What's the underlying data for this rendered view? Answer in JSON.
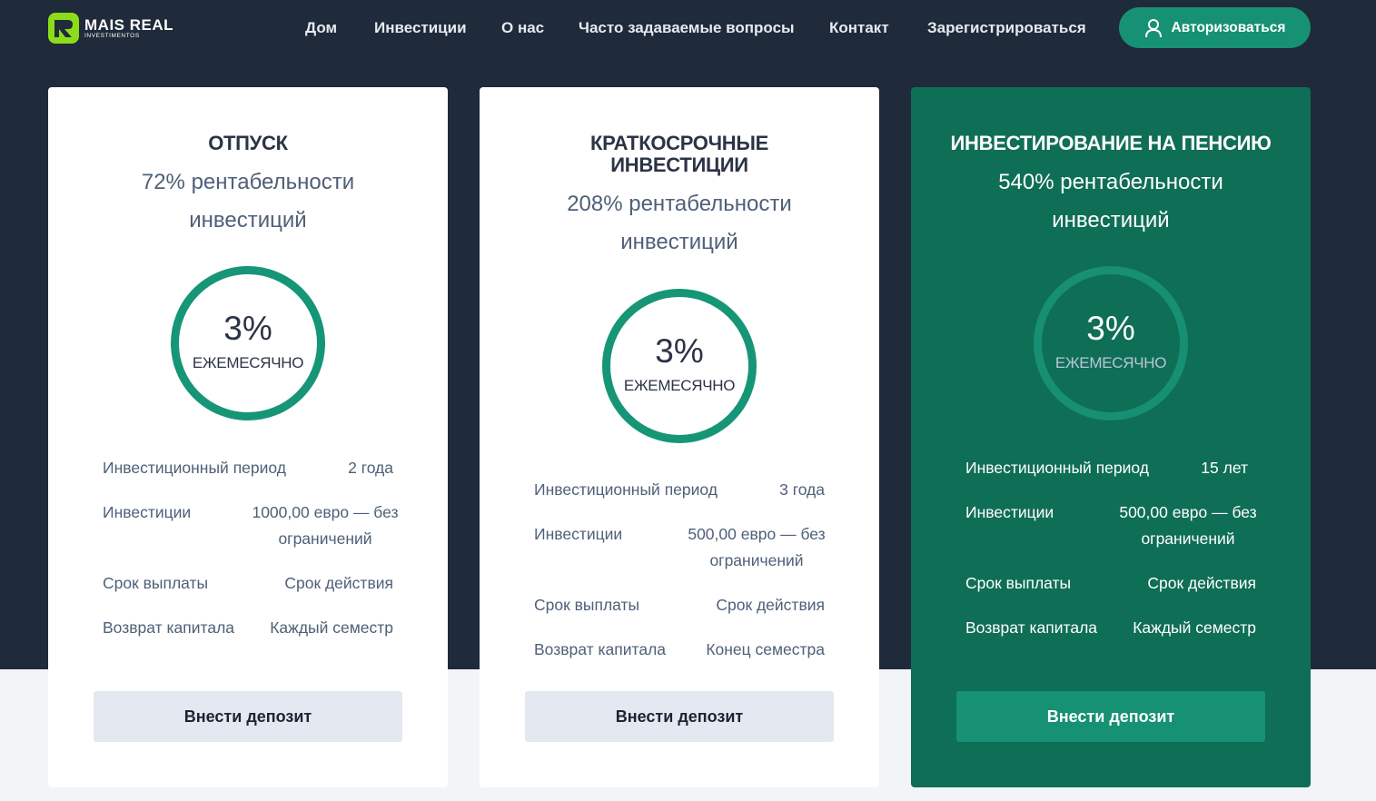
{
  "brand": {
    "name": "MAIS REAL",
    "sub": "INVESTIMENTOS",
    "accent": "#8bdc19"
  },
  "nav": {
    "items": [
      "Дом",
      "Инвестиции",
      "О нас",
      "Часто задаваемые вопросы",
      "Контакт",
      "Зарегистрироваться"
    ],
    "login_label": "Авторизоваться",
    "login_icon": "user-icon"
  },
  "colors": {
    "header_bg": "#1f2a3a",
    "accent_green": "#179173",
    "featured_bg": "#0f6e56"
  },
  "plans": [
    {
      "title": "ОТПУСК",
      "return_text": "72% рентабельности инвестиций",
      "rate": "3%",
      "rate_period": "ЕЖЕМЕСЯЧНО",
      "rows": [
        {
          "label": "Инвестиционный период",
          "value": "2 года"
        },
        {
          "label": "Инвестиции",
          "value": "1000,00 евро — без ограничений"
        },
        {
          "label": "Срок выплаты",
          "value": "Срок действия"
        },
        {
          "label": "Возврат капитала",
          "value": "Каждый семестр"
        }
      ],
      "button": "Внести депозит"
    },
    {
      "title": "КРАТКОСРОЧНЫЕ ИНВЕСТИЦИИ",
      "return_text": "208% рентабельности инвестиций",
      "rate": "3%",
      "rate_period": "ЕЖЕМЕСЯЧНО",
      "rows": [
        {
          "label": "Инвестиционный период",
          "value": "3 года"
        },
        {
          "label": "Инвестиции",
          "value": "500,00 евро — без ограничений"
        },
        {
          "label": "Срок выплаты",
          "value": "Срок действия"
        },
        {
          "label": "Возврат капитала",
          "value": "Конец семестра"
        }
      ],
      "button": "Внести депозит"
    },
    {
      "title": "ИНВЕСТИРОВАНИЕ НА ПЕНСИЮ",
      "return_text": "540% рентабельности инвестиций",
      "rate": "3%",
      "rate_period": "ЕЖЕМЕСЯЧНО",
      "rows": [
        {
          "label": "Инвестиционный период",
          "value": "15 лет"
        },
        {
          "label": "Инвестиции",
          "value": "500,00 евро — без ограничений"
        },
        {
          "label": "Срок выплаты",
          "value": "Срок действия"
        },
        {
          "label": "Возврат капитала",
          "value": "Каждый семестр"
        }
      ],
      "button": "Внести депозит"
    }
  ]
}
